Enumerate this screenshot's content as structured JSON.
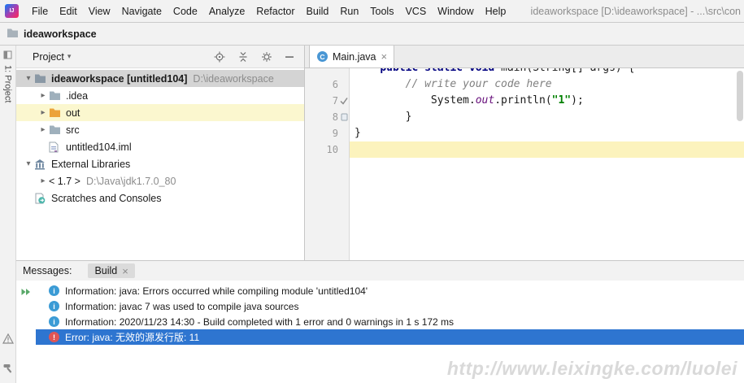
{
  "colors": {
    "selection": "#2E75D0",
    "current_line": "#FCF3BD",
    "excluded_row": "#FBF7CF",
    "keyword": "#000080",
    "string": "#008000",
    "comment": "#808080",
    "field": "#660E7A",
    "info_icon": "#3B9BD5",
    "error_icon": "#E05555",
    "folder": "#9FB0BC",
    "folder_root": "#8A98A5",
    "folder_excluded": "#ECA33B",
    "run_green": "#59A869"
  },
  "icon_glyphs": {
    "logo": "IJ",
    "class_letter": "C",
    "close": "×",
    "info": "i",
    "error": "!"
  },
  "menubar": {
    "items": [
      "File",
      "Edit",
      "View",
      "Navigate",
      "Code",
      "Analyze",
      "Refactor",
      "Build",
      "Run",
      "Tools",
      "VCS",
      "Window",
      "Help"
    ],
    "window_title": "ideaworkspace [D:\\ideaworkspace] - ...\\src\\con"
  },
  "navbar": {
    "breadcrumb": "ideaworkspace"
  },
  "left_stripe": {
    "project_tab": "1: Project"
  },
  "project_panel": {
    "title": "Project",
    "tree": [
      {
        "name": "root",
        "indent": 0,
        "arrow": "down",
        "icon": "folder-root",
        "label": "ideaworkspace [untitled104]",
        "bold": true,
        "suffix": "D:\\ideaworkspace",
        "bg": "selected"
      },
      {
        "name": "idea-folder",
        "indent": 1,
        "arrow": "right",
        "icon": "folder",
        "label": ".idea"
      },
      {
        "name": "out-folder",
        "indent": 1,
        "arrow": "right",
        "icon": "folder-excluded",
        "label": "out",
        "bg": "excluded"
      },
      {
        "name": "src-folder",
        "indent": 1,
        "arrow": "right",
        "icon": "folder",
        "label": "src"
      },
      {
        "name": "iml-file",
        "indent": 1,
        "arrow": "none",
        "icon": "iml",
        "label": "untitled104.iml"
      },
      {
        "name": "external-libraries",
        "indent": 0,
        "arrow": "down",
        "icon": "library",
        "label": "External Libraries"
      },
      {
        "name": "jdk-1-7",
        "indent": 1,
        "arrow": "right",
        "icon": "none",
        "label": "< 1.7 >",
        "suffix": "D:\\Java\\jdk1.7.0_80"
      },
      {
        "name": "scratches-and-consoles",
        "indent": 0,
        "arrow": "none",
        "icon": "scratch",
        "label": "Scratches and Consoles"
      }
    ]
  },
  "editor": {
    "tab": "Main.java",
    "lines": [
      {
        "num": "",
        "gutter": "",
        "tokens": [
          {
            "t": "    ",
            "s": "p"
          },
          {
            "t": "public static void ",
            "s": "k"
          },
          {
            "t": "main(String[] args) {",
            "s": "p"
          }
        ]
      },
      {
        "num": "6",
        "gutter": "",
        "tokens": [
          {
            "t": "        ",
            "s": "p"
          },
          {
            "t": "// write your code here",
            "s": "c"
          }
        ]
      },
      {
        "num": "7",
        "gutter": "check",
        "tokens": [
          {
            "t": "            System.",
            "s": "p"
          },
          {
            "t": "out",
            "s": "f"
          },
          {
            "t": ".println(",
            "s": "p"
          },
          {
            "t": "\"1\"",
            "s": "s"
          },
          {
            "t": ");",
            "s": "p"
          }
        ]
      },
      {
        "num": "8",
        "gutter": "marker",
        "tokens": [
          {
            "t": "        }",
            "s": "p"
          }
        ]
      },
      {
        "num": "9",
        "gutter": "",
        "tokens": [
          {
            "t": "}",
            "s": "p"
          }
        ]
      },
      {
        "num": "10",
        "gutter": "",
        "tokens": [],
        "current": true
      }
    ]
  },
  "build_panel": {
    "title": "Messages:",
    "tab": "Build",
    "messages": [
      {
        "type": "info",
        "text": "Information: java: Errors occurred while compiling module 'untitled104'"
      },
      {
        "type": "info",
        "text": "Information: javac 7 was used to compile java sources"
      },
      {
        "type": "info",
        "text": "Information: 2020/11/23 14:30 - Build completed with 1 error and 0 warnings in 1 s 172 ms"
      },
      {
        "type": "error",
        "text": "Error: java: 无效的源发行版: 11",
        "selected": true
      }
    ]
  },
  "watermark": "http://www.leixingke.com/luolei"
}
